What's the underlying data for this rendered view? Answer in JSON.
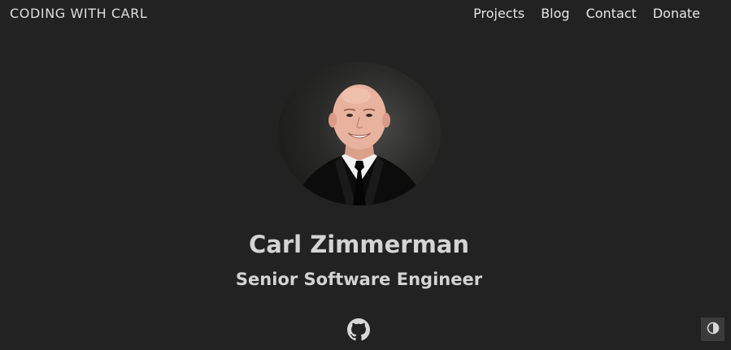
{
  "header": {
    "site_title": "CODING WITH CARL",
    "nav": [
      {
        "label": "Projects"
      },
      {
        "label": "Blog"
      },
      {
        "label": "Contact"
      },
      {
        "label": "Donate"
      }
    ]
  },
  "profile": {
    "name": "Carl Zimmerman",
    "role": "Senior Software Engineer",
    "photo_icon": "profile-photo",
    "social": [
      {
        "icon": "github-icon"
      }
    ]
  },
  "controls": {
    "theme_toggle_icon": "contrast-icon"
  },
  "colors": {
    "background": "#222222",
    "text": "#dcdcdc",
    "toggle_bg": "#3b3b3b"
  }
}
